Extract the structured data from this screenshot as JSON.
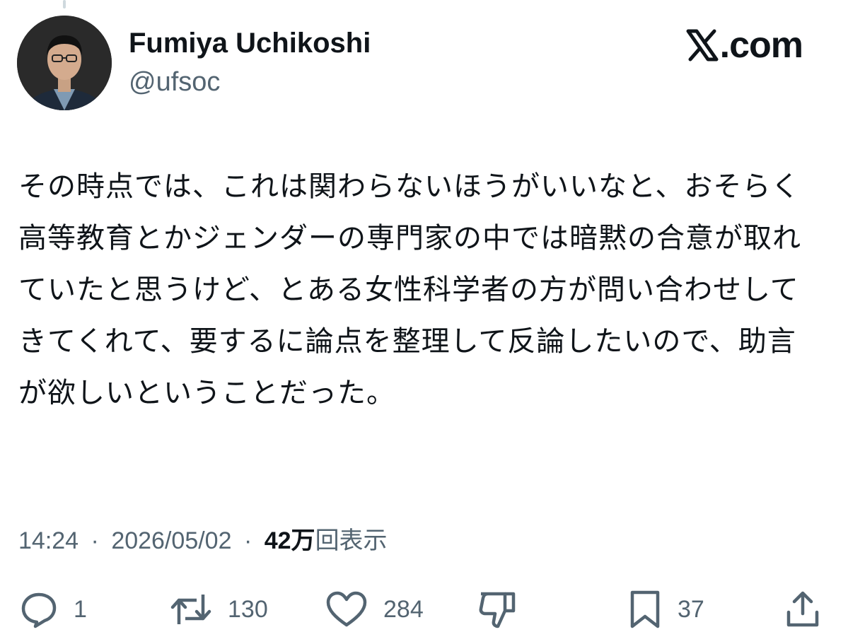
{
  "author": {
    "display_name": "Fumiya Uchikoshi",
    "handle": "@ufsoc"
  },
  "brand": {
    "label": ".com",
    "icon": "x-logo-icon"
  },
  "tweet": {
    "text": "その時点では、これは関わらないほうがいいなと、おそらく高等教育とかジェンダーの専門家の中では暗黙の合意が取れていたと思うけど、とある女性科学者の方が問い合わせしてきてくれて、要するに論点を整理して反論したいので、助言が欲しいということだった。"
  },
  "meta": {
    "time": "14:24",
    "separator": "·",
    "date": "2026/05/02",
    "views_count": "42万",
    "views_label": "回表示"
  },
  "actions": {
    "reply": {
      "icon": "reply-icon",
      "count": "1"
    },
    "repost": {
      "icon": "repost-icon",
      "count": "130"
    },
    "like": {
      "icon": "heart-icon",
      "count": "284"
    },
    "dislike": {
      "icon": "thumbs-down-icon"
    },
    "bookmark": {
      "icon": "bookmark-icon",
      "count": "37"
    },
    "share": {
      "icon": "share-icon"
    }
  },
  "colors": {
    "text_primary": "#0f1419",
    "text_secondary": "#536471"
  }
}
